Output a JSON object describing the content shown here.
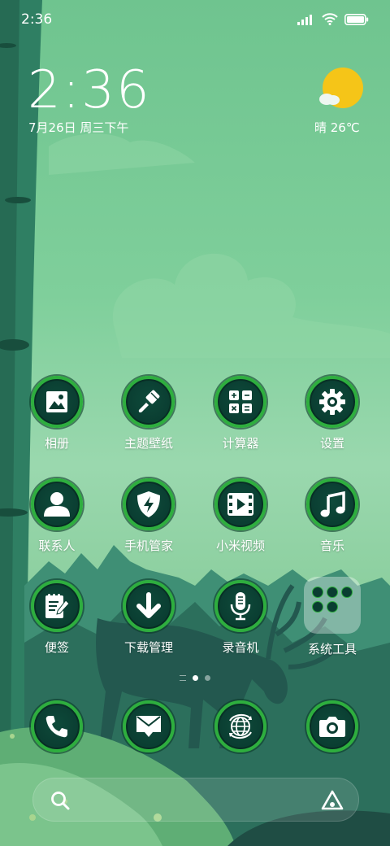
{
  "status_bar": {
    "time": "2:36"
  },
  "clock": {
    "time": "2:36",
    "date": "7月26日 周三下午"
  },
  "weather": {
    "text": "晴 26℃",
    "icon": "sun-cloud-icon"
  },
  "apps": [
    {
      "label": "相册",
      "icon": "gallery-icon"
    },
    {
      "label": "主题壁纸",
      "icon": "brush-icon"
    },
    {
      "label": "计算器",
      "icon": "calculator-icon"
    },
    {
      "label": "设置",
      "icon": "gear-icon"
    },
    {
      "label": "联系人",
      "icon": "person-icon"
    },
    {
      "label": "手机管家",
      "icon": "shield-bolt-icon"
    },
    {
      "label": "小米视频",
      "icon": "film-play-icon"
    },
    {
      "label": "音乐",
      "icon": "music-note-icon"
    },
    {
      "label": "便签",
      "icon": "notepad-icon"
    },
    {
      "label": "下载管理",
      "icon": "download-arrow-icon"
    },
    {
      "label": "录音机",
      "icon": "microphone-icon"
    },
    {
      "label": "系统工具",
      "icon": "folder-icon"
    }
  ],
  "dock": [
    {
      "icon": "phone-icon"
    },
    {
      "icon": "message-icon"
    },
    {
      "icon": "browser-globe-icon"
    },
    {
      "icon": "camera-icon"
    }
  ],
  "colors": {
    "icon_ring": "#2eae3e",
    "icon_bg": "#0a3d31",
    "weather_sun": "#f5c518"
  }
}
